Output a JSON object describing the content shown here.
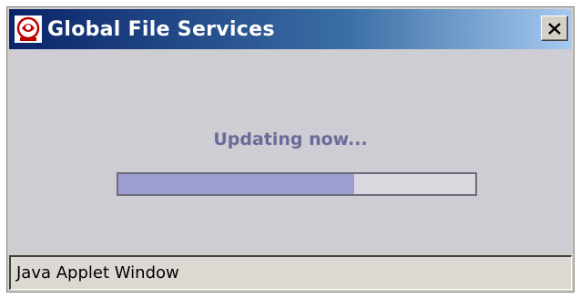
{
  "window": {
    "title": "Global File Services",
    "icon": "app-logo-icon",
    "close_icon": "close-icon"
  },
  "content": {
    "status_message": "Updating now...",
    "progress_fraction": 0.66
  },
  "statusbar": {
    "text": "Java Applet Window"
  },
  "colors": {
    "title_gradient_start": "#0a246a",
    "title_gradient_end": "#a6caf0",
    "progress_fill": "#9d9dd0",
    "status_text": "#6b6b9a"
  }
}
